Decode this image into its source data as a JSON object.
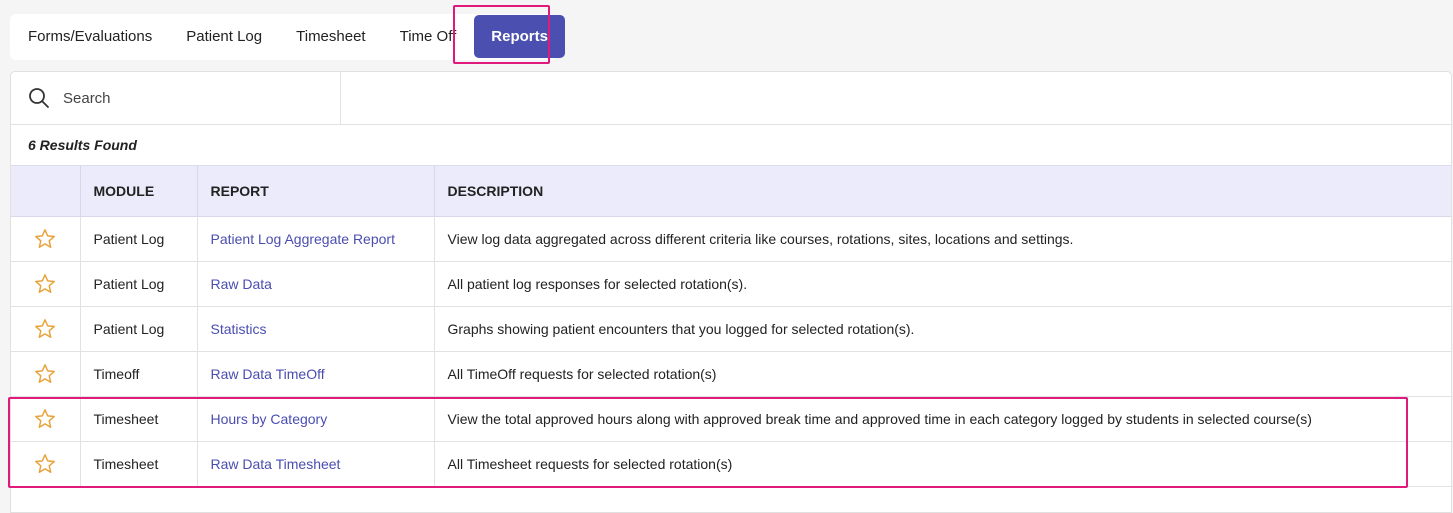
{
  "tabs": [
    {
      "label": "Forms/Evaluations",
      "active": false
    },
    {
      "label": "Patient Log",
      "active": false
    },
    {
      "label": "Timesheet",
      "active": false
    },
    {
      "label": "Time Off",
      "active": false
    },
    {
      "label": "Reports",
      "active": true
    }
  ],
  "search": {
    "placeholder": "Search",
    "value": ""
  },
  "results_label": "6 Results Found",
  "table": {
    "columns": [
      "",
      "MODULE",
      "REPORT",
      "DESCRIPTION"
    ],
    "rows": [
      {
        "module": "Patient Log",
        "report": "Patient Log Aggregate Report",
        "description": "View log data aggregated across different criteria like courses, rotations, sites, locations and settings."
      },
      {
        "module": "Patient Log",
        "report": "Raw Data",
        "description": "All patient log responses for selected rotation(s)."
      },
      {
        "module": "Patient Log",
        "report": "Statistics",
        "description": "Graphs showing patient encounters that you logged for selected rotation(s)."
      },
      {
        "module": "Timeoff",
        "report": "Raw Data TimeOff",
        "description": "All TimeOff requests for selected rotation(s)"
      },
      {
        "module": "Timesheet",
        "report": "Hours by Category",
        "description": "View the total approved hours along with approved break time and approved time in each category logged by students in selected course(s)"
      },
      {
        "module": "Timesheet",
        "report": "Raw Data Timesheet",
        "description": "All Timesheet requests for selected rotation(s)"
      }
    ]
  },
  "colors": {
    "accent": "#4b4fb0",
    "highlight": "#e0197d",
    "star": "#e8a23a",
    "header_bg": "#ebebfb",
    "link": "#4a4db0"
  }
}
